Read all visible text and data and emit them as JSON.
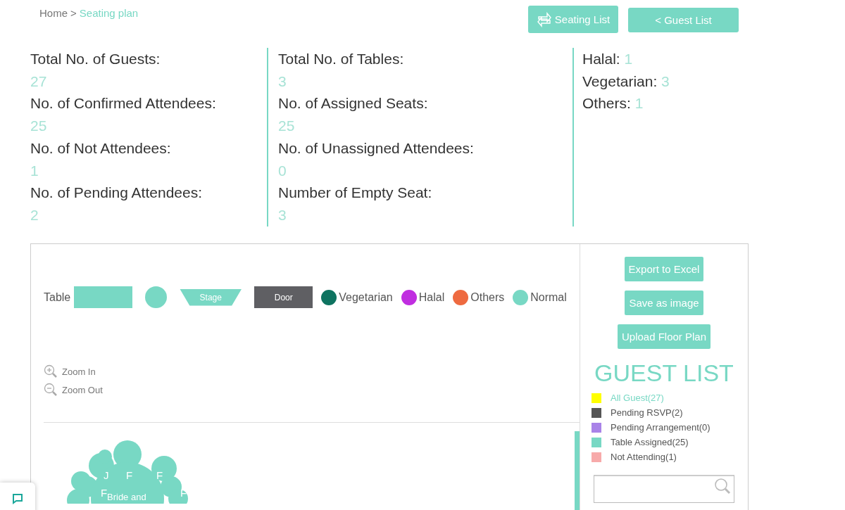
{
  "breadcrumb": {
    "home": "Home",
    "separator": ">",
    "current": "Seating plan"
  },
  "header_buttons": [
    {
      "label": "Seating List",
      "kind": "swap"
    },
    {
      "label": "< Guest List",
      "kind": "plain"
    }
  ],
  "stats": [
    [
      {
        "label": "Total No. of Guests:",
        "value": "27"
      },
      {
        "label": "No. of Confirmed Attendees:",
        "value": "25"
      },
      {
        "label": "No. of Not Attendees:",
        "value": "1"
      },
      {
        "label": "No. of Pending Attendees:",
        "value": "2"
      }
    ],
    [
      {
        "label": "Total No. of Tables:",
        "value": "3"
      },
      {
        "label": "No. of Assigned Seats:",
        "value": "25"
      },
      {
        "label": "No. of Unassigned Attendees:",
        "value": "0"
      },
      {
        "label": "Number of Empty Seat:",
        "value": "3"
      }
    ],
    [
      {
        "label": "Halal:",
        "value": "1"
      },
      {
        "label": "Vegetarian:",
        "value": "3"
      },
      {
        "label": "Others:",
        "value": "1"
      }
    ]
  ],
  "legend": {
    "label": "Table",
    "shapes": [
      {
        "kind": "rect"
      },
      {
        "kind": "circle"
      },
      {
        "kind": "stage",
        "text": "Stage"
      },
      {
        "kind": "door",
        "text": "Door"
      }
    ],
    "diets": [
      {
        "label": "Vegetarian",
        "color": "#0e7360"
      },
      {
        "label": "Halal",
        "color": "#c02ee0"
      },
      {
        "label": "Others",
        "color": "#ee6a40"
      },
      {
        "label": "Normal",
        "color": "#78d8c4"
      }
    ]
  },
  "zoom": [
    {
      "label": "Zoom In",
      "kind": "in"
    },
    {
      "label": "Zoom Out",
      "kind": "out"
    }
  ],
  "floor_plan": {
    "table_label": "Bride and",
    "seats": [
      "J",
      "F",
      "F",
      "F",
      "F"
    ]
  },
  "actions": [
    "Export to Excel",
    "Save as image",
    "Upload Floor Plan"
  ],
  "guest_list": {
    "title": "GUEST LIST",
    "filters": [
      {
        "label": "All Guest(27)",
        "color": "#ffff00",
        "selected": true
      },
      {
        "label": "Pending RSVP(2)",
        "color": "#555555",
        "selected": false
      },
      {
        "label": "Pending Arrangement(0)",
        "color": "#a983e8",
        "selected": false
      },
      {
        "label": "Table Assigned(25)",
        "color": "#78d8c4",
        "selected": false
      },
      {
        "label": "Not Attending(1)",
        "color": "#f7aaaa",
        "selected": false
      }
    ]
  }
}
